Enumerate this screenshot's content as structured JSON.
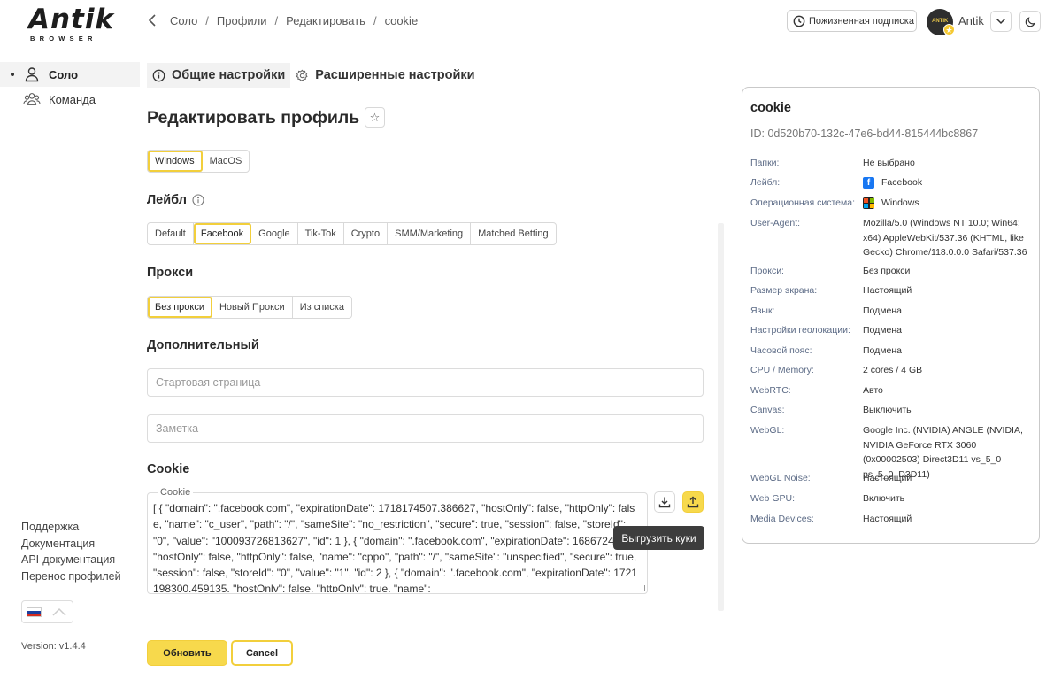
{
  "brand": {
    "name": "Antik",
    "tagline": "BROWSER"
  },
  "sidebar": {
    "items": [
      {
        "label": "Соло"
      },
      {
        "label": "Команда"
      }
    ],
    "links": [
      "Поддержка",
      "Документация",
      "API-документация",
      "Перенос профилей"
    ],
    "version": "Version: v1.4.4"
  },
  "breadcrumb": [
    "Соло",
    "Профили",
    "Редактировать",
    "cookie"
  ],
  "topbar": {
    "subscription": "Пожизненная подписка",
    "username": "Antik",
    "avatar_text": "ANTIK"
  },
  "tabs": [
    {
      "label": "Общие настройки"
    },
    {
      "label": "Расширенные настройки"
    }
  ],
  "form": {
    "title": "Редактировать профиль",
    "os_options": [
      "Windows",
      "MacOS"
    ],
    "label_heading": "Лейбл",
    "label_options": [
      "Default",
      "Facebook",
      "Google",
      "Tik-Tok",
      "Crypto",
      "SMM/Marketing",
      "Matched Betting"
    ],
    "proxy_heading": "Прокси",
    "proxy_options": [
      "Без прокси",
      "Новый Прокси",
      "Из списка"
    ],
    "additional_heading": "Дополнительный",
    "start_page_placeholder": "Стартовая страница",
    "note_placeholder": "Заметка",
    "cookie_heading": "Cookie",
    "cookie_legend": "Cookie",
    "cookie_value": "[ { \"domain\": \".facebook.com\", \"expirationDate\": 1718174507.386627, \"hostOnly\": false, \"httpOnly\": false, \"name\": \"c_user\", \"path\": \"/\", \"sameSite\": \"no_restriction\", \"secure\": true, \"session\": false, \"storeId\": \"0\", \"value\": \"100093726813627\", \"id\": 1 }, { \"domain\": \".facebook.com\", \"expirationDate\": 1686724921, \"hostOnly\": false, \"httpOnly\": false, \"name\": \"cppo\", \"path\": \"/\", \"sameSite\": \"unspecified\", \"secure\": true, \"session\": false, \"storeId\": \"0\", \"value\": \"1\", \"id\": 2 }, { \"domain\": \".facebook.com\", \"expirationDate\": 1721198300.459135, \"hostOnly\": false, \"httpOnly\": true, \"name\":",
    "export_tooltip": "Выгрузить куки",
    "submit_label": "Обновить",
    "cancel_label": "Cancel"
  },
  "card": {
    "title": "cookie",
    "id": "ID: 0d520b70-132c-47e6-bd44-815444bc8867",
    "rows": [
      {
        "key": "Папки:",
        "value": "Не выбрано"
      },
      {
        "key": "Лейбл:",
        "value": "Facebook",
        "icon": "facebook-icon"
      },
      {
        "key": "Операционная система:",
        "value": "Windows",
        "icon": "windows-icon"
      },
      {
        "key": "User-Agent:",
        "value": "Mozilla/5.0 (Windows NT 10.0; Win64; x64) AppleWebKit/537.36 (KHTML, like Gecko) Chrome/118.0.0.0 Safari/537.36"
      },
      {
        "key": "Прокси:",
        "value": "Без прокси"
      },
      {
        "key": "Размер экрана:",
        "value": "Настоящий"
      },
      {
        "key": "Язык:",
        "value": "Подмена"
      },
      {
        "key": "Настройки геолокации:",
        "value": "Подмена"
      },
      {
        "key": "Часовой пояс:",
        "value": "Подмена"
      },
      {
        "key": "CPU / Memory:",
        "value": "2 cores / 4 GB"
      },
      {
        "key": "WebRTC:",
        "value": "Авто"
      },
      {
        "key": "Canvas:",
        "value": "Выключить"
      },
      {
        "key": "WebGL:",
        "value": "Google Inc. (NVIDIA) ANGLE (NVIDIA, NVIDIA GeForce RTX 3060 (0x00002503) Direct3D11 vs_5_0 ps_5_0, D3D11)"
      },
      {
        "key": "WebGL Noise:",
        "value": "Настоящий"
      },
      {
        "key": "Web GPU:",
        "value": "Включить"
      },
      {
        "key": "Media Devices:",
        "value": "Настоящий"
      }
    ]
  },
  "colors": {
    "accent": "#f7d94c",
    "accent_border": "#f2cf3c",
    "facebook": "#1877f2"
  }
}
